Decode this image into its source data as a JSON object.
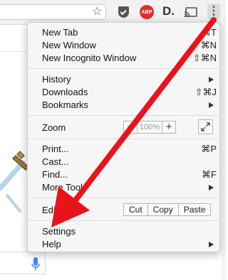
{
  "toolbar": {
    "star_icon": "star-icon",
    "abp_label": "ABP",
    "d_label": "D.",
    "menu_icon": "⋮"
  },
  "menu": {
    "new_tab": {
      "label": "New Tab",
      "shortcut": "⌘T"
    },
    "new_window": {
      "label": "New Window",
      "shortcut": "⌘N"
    },
    "new_incognito": {
      "label": "New Incognito Window",
      "shortcut": "⇧⌘N"
    },
    "history": {
      "label": "History"
    },
    "downloads": {
      "label": "Downloads",
      "shortcut": "⇧⌘J"
    },
    "bookmarks": {
      "label": "Bookmarks"
    },
    "zoom": {
      "label": "Zoom",
      "minus": "−",
      "value": "100%",
      "plus": "+"
    },
    "print": {
      "label": "Print...",
      "shortcut": "⌘P"
    },
    "cast": {
      "label": "Cast..."
    },
    "find": {
      "label": "Find...",
      "shortcut": "⌘F"
    },
    "more_tools": {
      "label": "More Tools"
    },
    "edit": {
      "label": "Edit",
      "cut": "Cut",
      "copy": "Copy",
      "paste": "Paste"
    },
    "settings": {
      "label": "Settings"
    },
    "help": {
      "label": "Help"
    }
  },
  "colors": {
    "annotation_arrow": "#e8141c",
    "abp_badge": "#d9332c"
  }
}
